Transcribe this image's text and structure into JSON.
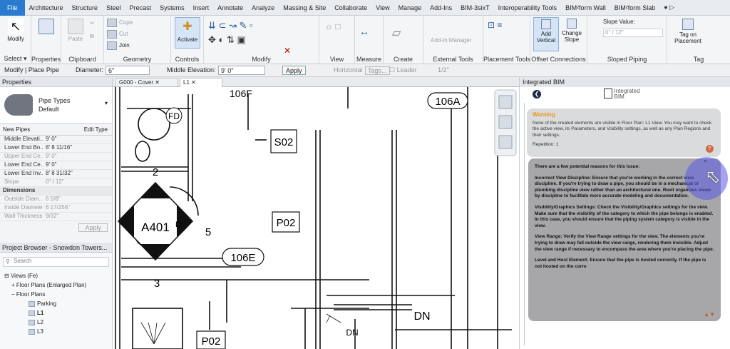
{
  "menubar": {
    "tabs": [
      "File",
      "Architecture",
      "Structure",
      "Steel",
      "Precast",
      "Systems",
      "Insert",
      "Annotate",
      "Analyze",
      "Massing & Site",
      "Collaborate",
      "View",
      "Manage",
      "Add-Ins",
      "BIM-3sixT",
      "Interoperability Tools",
      "BIM²form Wall",
      "BIM²form Slab"
    ]
  },
  "ribbon": {
    "modify": "Modify",
    "select": "Select ▾",
    "properties": "Properties",
    "clipboard": "Clipboard",
    "paste": "Paste",
    "cope": "Cope",
    "cut": "Cut",
    "join": "Join",
    "geometry": "Geometry",
    "activate": "Activate",
    "controls": "Controls",
    "modify_group": "Modify",
    "view": "View",
    "measure": "Measure",
    "create": "Create",
    "add_in_manager": "Add-In Manager",
    "external_tools": "External Tools",
    "placement_tools": "Placement Tools",
    "add_vertical": "Add Vertical",
    "change_slope": "Change Slope",
    "offset_connections": "Offset Connections",
    "slope_value_label": "Slope Value:",
    "slope_value": "0\" / 12\"",
    "sloped_piping": "Sloped Piping",
    "tag_on_placement": "Tag on Placement",
    "tag": "Tag"
  },
  "options": {
    "mode": "Modify | Place Pipe",
    "diameter_label": "Diameter:",
    "diameter": "6\"",
    "elevation_label": "Middle Elevation:",
    "elevation": "9' 0\"",
    "apply": "Apply",
    "horizontal": "Horizontal",
    "tags": "Tags...",
    "leader": "Leader",
    "leader_len": "1/2\""
  },
  "properties": {
    "title": "Properties",
    "type_name": "Pipe Types",
    "type_sub": "Default",
    "filter": "New Pipes",
    "edit_type": "Edit Type",
    "rows": [
      {
        "k": "Middle Elevati...",
        "v": "9' 0\"",
        "dim": false
      },
      {
        "k": "Lower End Bo...",
        "v": "8' 8 11/16\"",
        "dim": false
      },
      {
        "k": "Upper End Ce...",
        "v": "9' 0\"",
        "dim": true
      },
      {
        "k": "Lower End Ce...",
        "v": "9' 0\"",
        "dim": false
      },
      {
        "k": "Lower End Inv...",
        "v": "8' 8 31/32\"",
        "dim": false
      },
      {
        "k": "Slope",
        "v": "0\" / 12\"",
        "dim": true
      }
    ],
    "dimensions": "Dimensions",
    "dim_rows": [
      {
        "k": "Outside Diam...",
        "v": "6 5/8\""
      },
      {
        "k": "Inside Diameter",
        "v": "6 17/256\""
      },
      {
        "k": "Wall Thickness",
        "v": "9/32\""
      }
    ],
    "apply": "Apply"
  },
  "browser": {
    "title": "Project Browser - Snowdon Towers...",
    "search": "Search",
    "items": [
      "Views (Fe)",
      "Floor Plans (Enlarged Plan)",
      "Floor Plans",
      "Parking",
      "L1",
      "L2",
      "L3"
    ]
  },
  "canvas": {
    "tab1": "G000 - Cover",
    "tab2": "L1",
    "labels": [
      "106F",
      "P02",
      "S02",
      "106A",
      "FD",
      "2",
      "A401",
      "D",
      "5",
      "106E",
      "3",
      "DN",
      "DN",
      "P02"
    ]
  },
  "ibim": {
    "header": "Integrated BIM",
    "logo1": "Integrated",
    "logo2": "BIM",
    "warning_title": "Warning",
    "warning_text": "None of the created elements are visible in Floor Plan: L1 View. You may want to check the active view, its Parameters, and Visibility settings, as well as any Plan Regions and their settings.",
    "repetition": "Repetition: 1",
    "intro": "There are a few potential reasons for this issue:",
    "r1": "Incorrect View Discipline: Ensure that you're working in the correct view discipline. If you're trying to draw a pipe, you should be in a mechanical or plumbing discipline view rather than an architectural one. Revit organizes views by discipline to facilitate more accurate modeling and documentation.",
    "r2": "Visibility/Graphics Settings: Check the Visibility/Graphics settings for the view. Make sure that the visibility of the category to which the pipe belongs is enabled. In this case, you should ensure that the piping system category is visible in the view.",
    "r3": "View Range: Verify the View Range settings for the view. The elements you're trying to draw may fall outside the view range, rendering them invisible. Adjust the view range if necessary to encompass the area where you're placing the pipe.",
    "r4": "Level and Host Element: Ensure that the pipe is hosted correctly. If the pipe is not hosted on the corre"
  }
}
